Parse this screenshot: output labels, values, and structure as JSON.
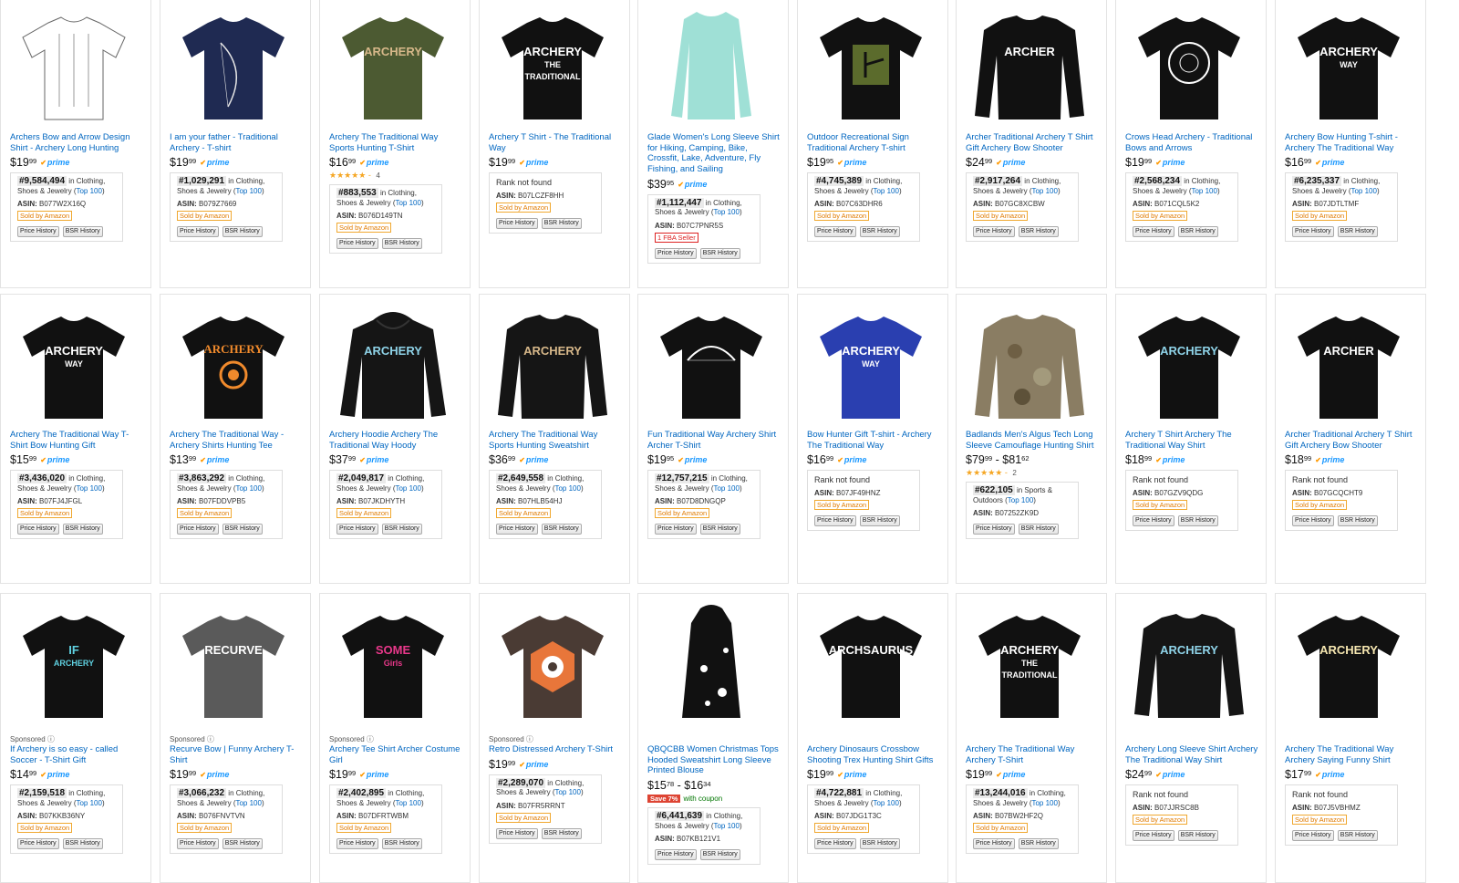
{
  "prime_label": "prime",
  "sponsored_label": "Sponsored",
  "sold_label": "Sold by Amazon",
  "price_history_label": "Price History",
  "bsr_history_label": "BSR History",
  "top100_label": "Top 100",
  "products": [
    {
      "title": "Archers Bow and Arrow Design Shirt - Archery Long Hunting",
      "price": "19",
      "cents": "99",
      "rank": "#9,584,494",
      "cat": "in Clothing, Shoes & Jewelry",
      "asin": "B077W2X16Q",
      "sold": true,
      "shirt": "#ffffff",
      "design": "#999999",
      "kind": "tee",
      "logo": "patent"
    },
    {
      "title": "I am your father - Traditional Archery - T-shirt",
      "price": "19",
      "cents": "99",
      "rank": "#1,029,291",
      "cat": "in Clothing, Shoes & Jewelry",
      "asin": "B079Z7669",
      "sold": true,
      "shirt": "#1f2a52",
      "design": "#e6e6e6",
      "kind": "tee",
      "logo": "bow"
    },
    {
      "title": "Archery The Traditional Way Sports Hunting T-Shirt",
      "price": "16",
      "cents": "99",
      "stars": "★★★★★",
      "reviews": "4",
      "rank": "#883,553",
      "cat": "in Clothing, Shoes & Jewelry",
      "asin": "B076D149TN",
      "sold": true,
      "shirt": "#4c5a32",
      "design": "#d7b88a",
      "kind": "tee",
      "logo": "ARCHERY"
    },
    {
      "title": "Archery T Shirt - The Traditional Way",
      "price": "19",
      "cents": "99",
      "norank": "Rank not found",
      "asin": "B07LCZF8HH",
      "sold": true,
      "shirt": "#111111",
      "design": "#ffffff",
      "kind": "tee",
      "logo": "ARCHERY THE TRADITIONAL WAY"
    },
    {
      "title": "Glade Women's Long Sleeve Shirt for Hiking, Camping, Bike, Crossfit, Lake, Adventure, Fly Fishing, and Sailing",
      "price": "39",
      "cents": "95",
      "rank": "#1,112,447",
      "cat": "in Clothing, Shoes & Jewelry",
      "asin": "B07C7PNR5S",
      "fba": "1 FBA Seller",
      "shirt": "#9fe0d6",
      "design": "#9fe0d6",
      "kind": "women",
      "logo": ""
    },
    {
      "title": "Outdoor Recreational Sign Traditional Archery T-shirt",
      "price": "19",
      "cents": "95",
      "rank": "#4,745,389",
      "cat": "in Clothing, Shoes & Jewelry",
      "asin": "B07C63DHR6",
      "sold": true,
      "shirt": "#111111",
      "design": "#5b6b2c",
      "kind": "tee",
      "logo": "sign"
    },
    {
      "title": "Archer Traditional Archery T Shirt Gift Archery Bow Shooter",
      "price": "24",
      "cents": "99",
      "rank": "#2,917,264",
      "cat": "in Clothing, Shoes & Jewelry",
      "asin": "B07GC8XCBW",
      "sold": true,
      "shirt": "#111111",
      "design": "#ffffff",
      "kind": "long",
      "logo": "ARCHER"
    },
    {
      "title": "Crows Head Archery - Traditional Bows and Arrows",
      "price": "19",
      "cents": "99",
      "rank": "#2,568,234",
      "cat": "in Clothing, Shoes & Jewelry",
      "asin": "B071CQL5K2",
      "sold": true,
      "shirt": "#111111",
      "design": "#ffffff",
      "kind": "tee",
      "logo": "circle"
    },
    {
      "title": "Archery Bow Hunting T-shirt - Archery The Traditional Way",
      "price": "16",
      "cents": "99",
      "rank": "#6,235,337",
      "cat": "in Clothing, Shoes & Jewelry",
      "asin": "B07JDTLTMF",
      "sold": true,
      "shirt": "#111111",
      "design": "#ffffff",
      "kind": "tee",
      "logo": "ARCHERY WAY"
    },
    {
      "title": "Archery The Traditional Way T-Shirt Bow Hunting Gift",
      "price": "15",
      "cents": "99",
      "rank": "#3,436,020",
      "cat": "in Clothing, Shoes & Jewelry",
      "asin": "B07FJ4JFGL",
      "sold": true,
      "shirt": "#111111",
      "design": "#ffffff",
      "kind": "tee",
      "logo": "ARCHERY WAY"
    },
    {
      "title": "Archery The Traditional Way - Archery Shirts Hunting Tee",
      "price": "13",
      "cents": "99",
      "rank": "#3,863,292",
      "cat": "in Clothing, Shoes & Jewelry",
      "asin": "B07FDDVPB5",
      "sold": true,
      "shirt": "#111111",
      "design": "#f08a2c",
      "kind": "tee",
      "logo": "target"
    },
    {
      "title": "Archery Hoodie Archery The Traditional Way Hoody",
      "price": "37",
      "cents": "99",
      "rank": "#2,049,817",
      "cat": "in Clothing, Shoes & Jewelry",
      "asin": "B07JKDHYTH",
      "sold": true,
      "shirt": "#151515",
      "design": "#8fd3e8",
      "kind": "hoodie",
      "logo": "ARCHERY"
    },
    {
      "title": "Archery The Traditional Way Sports Hunting Sweatshirt",
      "price": "36",
      "cents": "99",
      "rank": "#2,649,558",
      "cat": "in Clothing, Shoes & Jewelry",
      "asin": "B07HLB54HJ",
      "sold": true,
      "shirt": "#151515",
      "design": "#d7b88a",
      "kind": "long",
      "logo": "ARCHERY"
    },
    {
      "title": "Fun Traditional Way Archery Shirt Archer T-Shirt",
      "price": "19",
      "cents": "95",
      "rank": "#12,757,215",
      "cat": "in Clothing, Shoes & Jewelry",
      "asin": "B07D8DNGQP",
      "sold": true,
      "shirt": "#111111",
      "design": "#ffffff",
      "kind": "tee",
      "logo": "bowarc"
    },
    {
      "title": "Bow Hunter Gift T-shirt - Archery The Traditional Way",
      "price": "16",
      "cents": "99",
      "norank": "Rank not found",
      "asin": "B07JF49HNZ",
      "sold": true,
      "shirt": "#2a3fb0",
      "design": "#ffffff",
      "kind": "tee",
      "logo": "ARCHERY WAY"
    },
    {
      "title": "Badlands Men's Algus Tech Long Sleeve Camouflage Hunting Shirt",
      "price": "79",
      "cents": "99",
      "price2": "81",
      "cents2": "62",
      "stars": "★★★★★",
      "reviews": "2",
      "rank": "#622,105",
      "cat": "in Sports & Outdoors",
      "asin": "B07252ZK9D",
      "sold": false,
      "shirt": "#8a7d63",
      "design": "#8a7d63",
      "kind": "camo",
      "logo": ""
    },
    {
      "title": "Archery T Shirt Archery The Traditional Way Shirt",
      "price": "18",
      "cents": "99",
      "norank": "Rank not found",
      "asin": "B07GZV9QDG",
      "sold": true,
      "shirt": "#111111",
      "design": "#8fd3e8",
      "kind": "tee",
      "logo": "ARCHERY"
    },
    {
      "title": "Archer Traditional Archery T Shirt Gift Archery Bow Shooter",
      "price": "18",
      "cents": "99",
      "norank": "Rank not found",
      "asin": "B07GCQCHT9",
      "sold": true,
      "shirt": "#111111",
      "design": "#ffffff",
      "kind": "tee",
      "logo": "ARCHER"
    },
    {
      "title": "If Archery is so easy - called Soccer - T-Shirt Gift",
      "sponsored": true,
      "price": "14",
      "cents": "99",
      "rank": "#2,159,518",
      "cat": "in Clothing, Shoes & Jewelry",
      "asin": "B07KKB36NY",
      "sold": true,
      "shirt": "#111111",
      "design": "#5fd0e0",
      "kind": "tee",
      "logo": "IF ARCHERY"
    },
    {
      "title": "Recurve Bow | Funny Archery T-Shirt",
      "sponsored": true,
      "price": "19",
      "cents": "99",
      "rank": "#3,066,232",
      "cat": "in Clothing, Shoes & Jewelry",
      "asin": "B076FNVTVN",
      "sold": true,
      "shirt": "#5a5a5a",
      "design": "#ffffff",
      "kind": "tee",
      "logo": "RECURVE"
    },
    {
      "title": "Archery Tee Shirt Archer Costume Girl",
      "sponsored": true,
      "price": "19",
      "cents": "99",
      "rank": "#2,402,895",
      "cat": "in Clothing, Shoes & Jewelry",
      "asin": "B07DFRTWBM",
      "sold": true,
      "shirt": "#111111",
      "design": "#e8388a",
      "kind": "tee",
      "logo": "SOME Girls"
    },
    {
      "title": "Retro Distressed Archery T-Shirt",
      "sponsored": true,
      "price": "19",
      "cents": "99",
      "rank": "#2,289,070",
      "cat": "in Clothing, Shoes & Jewelry",
      "asin": "B07FR5RRNT",
      "sold": true,
      "shirt": "#4a3b34",
      "design": "#e8763a",
      "kind": "tee",
      "logo": "hex"
    },
    {
      "title": "QBQCBB Women Christmas Tops Hooded Sweatshirt Long Sleeve Printed Blouse",
      "price": "15",
      "cents": "78",
      "price2": "16",
      "cents2": "34",
      "coupon": "Save 7%",
      "coupon_text": "with coupon",
      "rank": "#6,441,639",
      "cat": "in Clothing, Shoes & Jewelry",
      "asin": "B07KB121V1",
      "sold": false,
      "shirt": "#111111",
      "design": "#ffffff",
      "kind": "dress",
      "logo": ""
    },
    {
      "title": "Archery Dinosaurs Crossbow Shooting Trex Hunting Shirt Gifts",
      "price": "19",
      "cents": "99",
      "rank": "#4,722,881",
      "cat": "in Clothing, Shoes & Jewelry",
      "asin": "B07JDG1T3C",
      "sold": true,
      "shirt": "#111111",
      "design": "#ffffff",
      "kind": "tee",
      "logo": "ARCHSAURUS"
    },
    {
      "title": "Archery The Traditional Way Archery T-Shirt",
      "price": "19",
      "cents": "99",
      "rank": "#13,244,016",
      "cat": "in Clothing, Shoes & Jewelry",
      "asin": "B07BW2HF2Q",
      "sold": true,
      "shirt": "#111111",
      "design": "#ffffff",
      "kind": "tee",
      "logo": "ARCHERY THE TRADITIONAL WAY"
    },
    {
      "title": "Archery Long Sleeve Shirt Archery The Traditional Way Shirt",
      "price": "24",
      "cents": "99",
      "norank": "Rank not found",
      "asin": "B07JJRSC8B",
      "sold": true,
      "shirt": "#151515",
      "design": "#8fd3e8",
      "kind": "long",
      "logo": "ARCHERY"
    },
    {
      "title": "Archery The Traditional Way Archery Saying Funny Shirt",
      "price": "17",
      "cents": "99",
      "norank": "Rank not found",
      "asin": "B07J5VBHMZ",
      "sold": true,
      "shirt": "#111111",
      "design": "#f5e6b0",
      "kind": "tee",
      "logo": "ARCHERY"
    }
  ]
}
